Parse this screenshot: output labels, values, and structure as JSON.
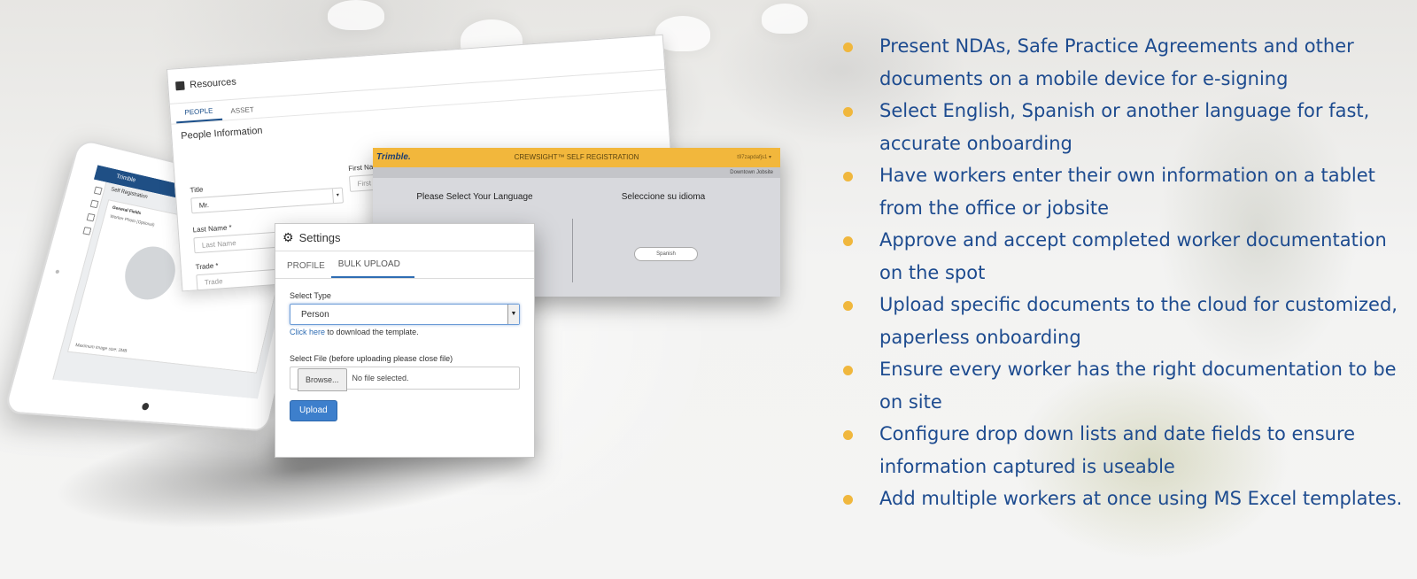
{
  "tablet": {
    "app_name": "Trimble",
    "screen_title": "Self Registration",
    "card_heading": "General Fields",
    "card_sub": "Worker Photo (Optional)",
    "card_footer": "Maximum image size: 2MB"
  },
  "resources": {
    "title": "Resources",
    "tabs": [
      "PEOPLE",
      "ASSET"
    ],
    "section": "People Information",
    "title_label": "Title",
    "title_value": "Mr.",
    "first_name_label": "First Name",
    "first_name_placeholder": "First N",
    "last_name_label": "Last Name *",
    "last_name_placeholder": "Last Name",
    "trade_label": "Trade *",
    "trade_placeholder": "Trade"
  },
  "crewsight": {
    "logo": "Trimble.",
    "title": "CREWSIGHT™ SELF REGISTRATION",
    "user": "t97zapdafjs1 ▾",
    "subheader": "Downtown Jobsite",
    "left_heading": "Please Select Your Language",
    "right_heading": "Seleccione su idioma",
    "spanish_button": "Spanish"
  },
  "settings": {
    "title": "Settings",
    "tabs": [
      "PROFILE",
      "BULK UPLOAD"
    ],
    "select_type_label": "Select Type",
    "select_type_value": "Person",
    "click_here_link": "Click here",
    "click_here_suffix": " to download the template.",
    "select_file_label": "Select File (before uploading please close file)",
    "browse_button": "Browse...",
    "no_file_text": "No file selected.",
    "upload_button": "Upload"
  },
  "bullets": [
    "Present NDAs, Safe Practice Agreements and other documents on a mobile device for e-signing",
    "Select English, Spanish or another language for fast, accurate onboarding",
    "Have workers enter their own information on a tablet from the office or jobsite",
    "Approve and accept completed worker documentation on the spot",
    "Upload specific documents to the cloud for customized, paperless onboarding",
    "Ensure every worker has the right documentation to be on site",
    "Configure drop down lists and date fields to ensure information captured is useable",
    "Add multiple workers at once using MS Excel templates."
  ],
  "colors": {
    "bullet_text": "#1d4b8f",
    "bullet_dot": "#f0b73d",
    "crewsight_header": "#f2b73c",
    "primary_button": "#3d7fcc"
  }
}
